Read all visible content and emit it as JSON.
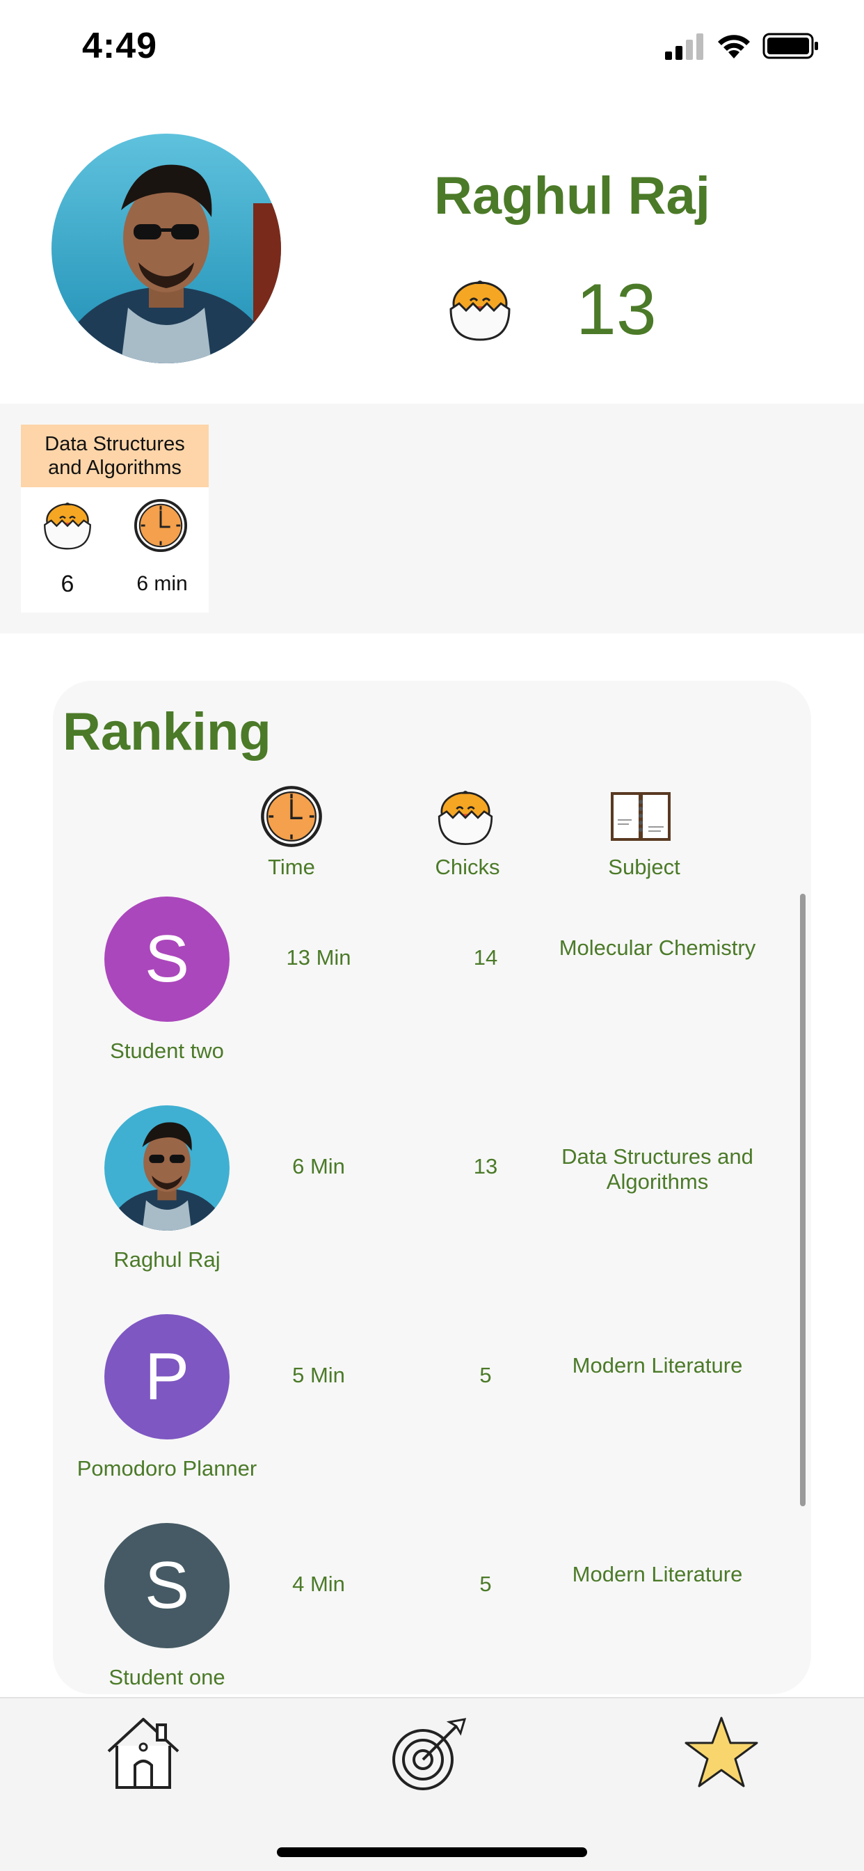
{
  "status_bar": {
    "time": "4:49"
  },
  "profile": {
    "name": "Raghul Raj",
    "chicks_total": "13"
  },
  "subject_summary": {
    "title": "Data Structures and Algorithms",
    "chicks": "6",
    "time": "6 min"
  },
  "ranking": {
    "title": "Ranking",
    "columns": [
      "Time",
      "Chicks",
      "Subject"
    ],
    "rows": [
      {
        "initial": "S",
        "name": "Student two",
        "time": "13 Min",
        "chicks": "14",
        "subject": "Molecular Chemistry",
        "avatar_color": "#ab47bc"
      },
      {
        "initial": "",
        "name": "Raghul Raj",
        "time": "6 Min",
        "chicks": "13",
        "subject": "Data Structures and Algorithms",
        "avatar_color": ""
      },
      {
        "initial": "P",
        "name": "Pomodoro Planner",
        "time": "5 Min",
        "chicks": "5",
        "subject": "Modern Literature",
        "avatar_color": "#7e57c2"
      },
      {
        "initial": "S",
        "name": "Student one",
        "time": "4 Min",
        "chicks": "5",
        "subject": "Modern Literature",
        "avatar_color": "#455a64"
      }
    ]
  },
  "tab_bar": {
    "items": [
      "home-icon",
      "target-icon",
      "star-icon"
    ]
  },
  "colors": {
    "accent_green": "#4b7a28",
    "card_header": "#fdd5a9",
    "clock_orange": "#f4a04c",
    "star_yellow": "#f8d66d"
  }
}
